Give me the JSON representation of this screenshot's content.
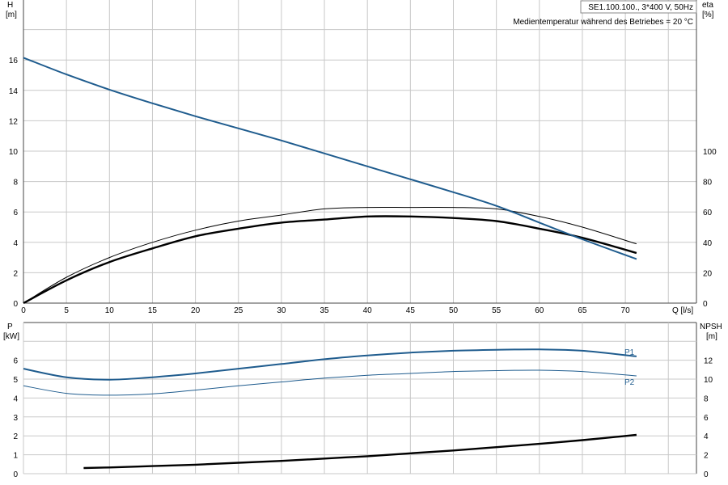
{
  "info": {
    "model": "SE1.100.100., 3*400 V, 50Hz",
    "medium": "Medientemperatur während des Betriebes = 20 °C"
  },
  "colors": {
    "blue": "#1f5c8e",
    "black": "#000000",
    "grid": "#c8c8c8"
  },
  "chart_data": [
    {
      "type": "line",
      "title": "",
      "ylabel": "H",
      "ylabel_unit": "[m]",
      "y2label": "eta",
      "y2label_unit": "[%]",
      "xlabel": "Q [l/s]",
      "xlim": [
        0,
        78
      ],
      "ylim": [
        0,
        19
      ],
      "y2lim": [
        0,
        190
      ],
      "xticks": [
        0,
        5,
        10,
        15,
        20,
        25,
        30,
        35,
        40,
        45,
        50,
        55,
        60,
        65,
        70
      ],
      "yticks": [
        0,
        2,
        4,
        6,
        8,
        10,
        12,
        14,
        16
      ],
      "y2ticks": [
        0,
        20,
        40,
        60,
        80,
        100
      ],
      "grid": true,
      "series": [
        {
          "axis": "left",
          "x": [
            0,
            5,
            10,
            15,
            20,
            25,
            30,
            35,
            40,
            45,
            50,
            55,
            60,
            65,
            71.3
          ],
          "y": [
            16.15,
            15.05,
            14.05,
            13.15,
            12.3,
            11.5,
            10.7,
            9.85,
            9.0,
            8.15,
            7.3,
            6.4,
            5.3,
            4.2,
            2.9
          ]
        },
        {
          "axis": "right",
          "x": [
            0,
            5,
            10,
            15,
            20,
            25,
            30,
            35,
            40,
            45,
            50,
            55,
            60,
            65,
            71.3
          ],
          "y": [
            0,
            17,
            30,
            40,
            48,
            54,
            58,
            62,
            63,
            63,
            63,
            62,
            57,
            50,
            39
          ]
        },
        {
          "axis": "right",
          "x": [
            0,
            5,
            10,
            15,
            20,
            25,
            30,
            35,
            40,
            45,
            50,
            55,
            60,
            65,
            71.3
          ],
          "y": [
            0,
            15,
            27,
            36,
            44,
            49,
            53,
            55,
            57,
            57,
            56,
            54,
            49,
            43,
            33
          ]
        }
      ]
    },
    {
      "type": "line",
      "title": "",
      "ylabel": "P",
      "ylabel_unit": "[kW]",
      "y2label": "NPSH",
      "y2label_unit": "[m]",
      "xlabel": "",
      "xlim": [
        0,
        78
      ],
      "ylim": [
        0,
        7.6
      ],
      "y2lim": [
        0,
        15.2
      ],
      "yticks": [
        0,
        1,
        2,
        3,
        4,
        5,
        6
      ],
      "y2ticks": [
        0,
        2,
        4,
        6,
        8,
        10,
        12
      ],
      "grid": true,
      "series": [
        {
          "name": "P1",
          "axis": "left",
          "x": [
            0,
            5,
            10,
            15,
            20,
            25,
            30,
            35,
            40,
            45,
            50,
            55,
            60,
            65,
            71.3
          ],
          "y": [
            5.55,
            5.1,
            4.97,
            5.1,
            5.3,
            5.55,
            5.8,
            6.05,
            6.25,
            6.4,
            6.5,
            6.55,
            6.57,
            6.5,
            6.2
          ]
        },
        {
          "name": "P2",
          "axis": "left",
          "x": [
            0,
            5,
            10,
            15,
            20,
            25,
            30,
            35,
            40,
            45,
            50,
            55,
            60,
            65,
            71.3
          ],
          "y": [
            4.65,
            4.25,
            4.15,
            4.22,
            4.42,
            4.65,
            4.85,
            5.05,
            5.2,
            5.3,
            5.4,
            5.45,
            5.47,
            5.4,
            5.17
          ]
        },
        {
          "axis": "right",
          "x": [
            7,
            10,
            15,
            20,
            25,
            30,
            35,
            40,
            45,
            50,
            55,
            60,
            65,
            71.3
          ],
          "y": [
            0.6,
            0.66,
            0.8,
            0.95,
            1.15,
            1.35,
            1.6,
            1.85,
            2.15,
            2.45,
            2.8,
            3.15,
            3.55,
            4.1
          ]
        }
      ]
    }
  ]
}
